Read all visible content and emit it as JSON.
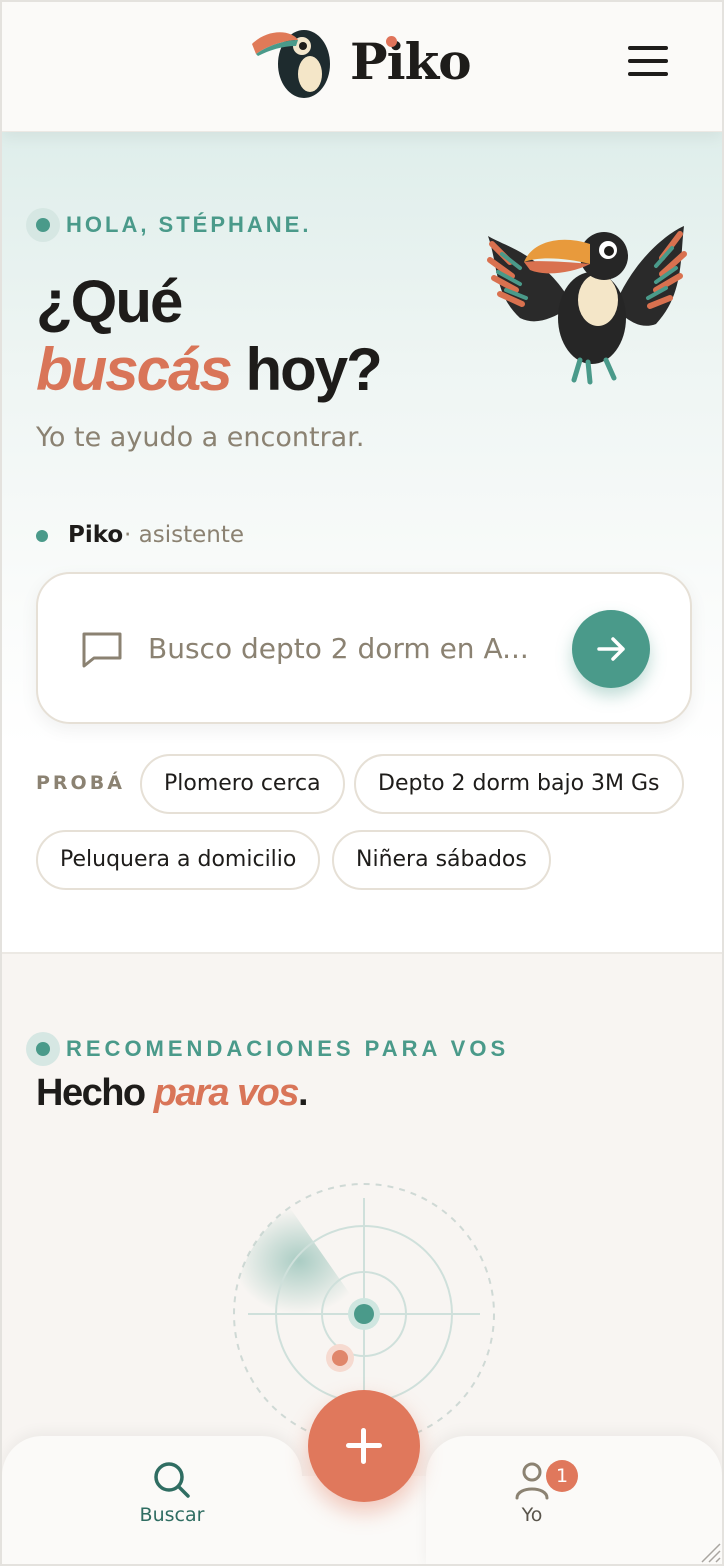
{
  "header": {
    "brand": "Piko",
    "logo_icon": "toucan-logo-icon",
    "menu_icon": "hamburger-menu-icon"
  },
  "hero": {
    "greeting": "HOLA, STÉPHANE.",
    "title_line1": "¿Qué",
    "title_accent": "buscás",
    "title_rest": "hoy?",
    "subtitle": "Yo te ayudo a encontrar.",
    "mascot_icon": "toucan-mascot-icon"
  },
  "assistant": {
    "name": "Piko",
    "role": "· asistente"
  },
  "search": {
    "placeholder": "Busco depto 2 dorm en A...",
    "chat_icon": "chat-bubble-icon",
    "send_icon": "arrow-right-icon"
  },
  "suggestions": {
    "label": "PROBÁ",
    "chips": [
      "Plomero cerca",
      "Depto 2 dorm bajo 3M Gs",
      "Peluquera a domicilio",
      "Niñera sábados"
    ]
  },
  "recommendations": {
    "label": "RECOMENDACIONES PARA VOS",
    "title_start": "Hecho",
    "title_accent": "para vos",
    "title_end": "."
  },
  "nav": {
    "search_label": "Buscar",
    "profile_label": "Yo",
    "profile_badge": "1",
    "fab_icon": "plus-icon"
  },
  "colors": {
    "teal": "#4a9a8a",
    "coral": "#d97558",
    "dark": "#1e1c1a",
    "muted": "#8b8272"
  }
}
